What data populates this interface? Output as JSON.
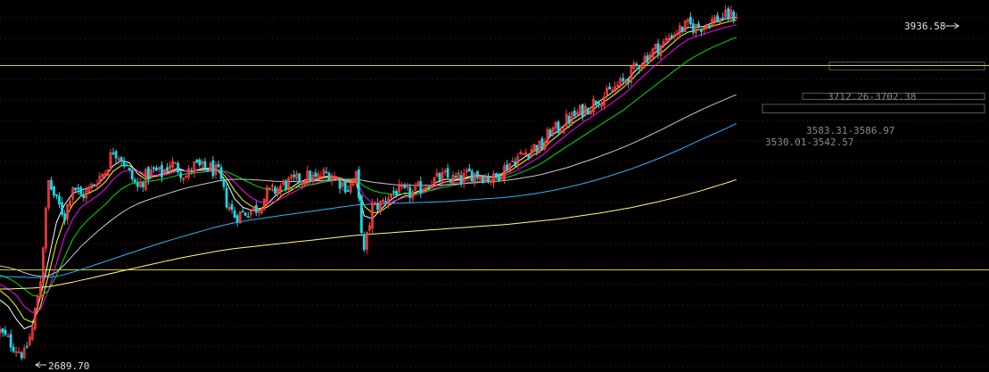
{
  "chart_data": {
    "type": "candlestick",
    "y_scale": "log",
    "ylim": [
      2650,
      4000
    ],
    "grid": true,
    "colors": {
      "background": "#000000",
      "grid": "#8b0000",
      "up": "#ff3c3c",
      "down": "#18d8e8",
      "level_line": "#d4d400",
      "zone_border": "#5a5a5a"
    },
    "annotations": {
      "high_label": "3936.58",
      "low_label": "2689.70",
      "zones": [
        {
          "label": "3712.26-3702.38",
          "low": 3702.38,
          "high": 3712.26
        },
        {
          "label": "3583.31-3586.97",
          "low": 3583.31,
          "high": 3586.97
        },
        {
          "label": "3530.01-3542.57",
          "low": 3530.01,
          "high": 3542.57
        }
      ],
      "horizontal_levels": [
        3720,
        2970
      ]
    },
    "indices": [
      0,
      3,
      6,
      9,
      12,
      15,
      18,
      21,
      24,
      27,
      30,
      33,
      36,
      39,
      42,
      45,
      48,
      51,
      54,
      57,
      60,
      63,
      66,
      69,
      72,
      75,
      78,
      81,
      84,
      87,
      90,
      93,
      96,
      99,
      102,
      105,
      108,
      111,
      114,
      117,
      120,
      123,
      126,
      129,
      132,
      135,
      138,
      141,
      144,
      147,
      150,
      153,
      156,
      159,
      162,
      165,
      168,
      171,
      174,
      177,
      180,
      183,
      186,
      189,
      192,
      195,
      198,
      201,
      204,
      207,
      210,
      213,
      216,
      219,
      222,
      225,
      228,
      231,
      234,
      237,
      240,
      243,
      246,
      249,
      252,
      255,
      258,
      261,
      264,
      267,
      270,
      273,
      276,
      279,
      282,
      285,
      288,
      291,
      294,
      297,
      300,
      303,
      306,
      309,
      312,
      315,
      318,
      321,
      324,
      327,
      330,
      333,
      336,
      339,
      342,
      345,
      348,
      351,
      354,
      357,
      360
    ],
    "closes": [
      2770,
      2745,
      2720,
      2700,
      2780,
      2940,
      3270,
      3200,
      3150,
      3260,
      3220,
      3240,
      3280,
      3310,
      3390,
      3360,
      3300,
      3250,
      3290,
      3310,
      3300,
      3340,
      3320,
      3290,
      3330,
      3320,
      3320,
      3300,
      3200,
      3150,
      3160,
      3170,
      3180,
      3230,
      3240,
      3260,
      3270,
      3280,
      3290,
      3280,
      3300,
      3300,
      3270,
      3250,
      3290,
      3020,
      3180,
      3190,
      3220,
      3240,
      3230,
      3230,
      3250,
      3270,
      3280,
      3290,
      3280,
      3280,
      3300,
      3300,
      3290,
      3280,
      3310,
      3340,
      3360,
      3380,
      3400,
      3400,
      3460,
      3470,
      3500,
      3520,
      3540,
      3560,
      3590,
      3600,
      3630,
      3650,
      3690,
      3730,
      3760,
      3790,
      3810,
      3850,
      3870,
      3890,
      3880,
      3890,
      3910,
      3920,
      3930,
      3936.58
    ],
    "ma_series": [
      {
        "values": [
          2870,
          2850,
          2810,
          2780,
          2790,
          2880,
          3000,
          3130,
          3190,
          3230,
          3240,
          3250,
          3260,
          3290,
          3330,
          3350,
          3340,
          3300,
          3280,
          3290,
          3300,
          3310,
          3320,
          3310,
          3310,
          3320,
          3320,
          3310,
          3270,
          3210,
          3180,
          3170,
          3170,
          3190,
          3220,
          3240,
          3250,
          3270,
          3280,
          3280,
          3290,
          3290,
          3280,
          3270,
          3270,
          3150,
          3140,
          3170,
          3200,
          3220,
          3230,
          3230,
          3240,
          3250,
          3270,
          3280,
          3280,
          3280,
          3290,
          3295,
          3292,
          3288,
          3300,
          3320,
          3345,
          3365,
          3385,
          3400,
          3440,
          3460,
          3490,
          3510,
          3530,
          3550,
          3575,
          3595,
          3620,
          3645,
          3680,
          3715,
          3745,
          3775,
          3800,
          3835,
          3860,
          3880,
          3880,
          3885,
          3900,
          3910,
          3920,
          3925
        ]
      },
      {
        "values": [
          2900,
          2880,
          2850,
          2810,
          2800,
          2850,
          2950,
          3060,
          3140,
          3190,
          3220,
          3230,
          3245,
          3270,
          3310,
          3330,
          3330,
          3310,
          3290,
          3290,
          3295,
          3305,
          3315,
          3310,
          3310,
          3315,
          3320,
          3315,
          3285,
          3240,
          3205,
          3185,
          3175,
          3180,
          3200,
          3225,
          3240,
          3260,
          3270,
          3275,
          3285,
          3290,
          3285,
          3275,
          3270,
          3185,
          3160,
          3165,
          3185,
          3205,
          3220,
          3225,
          3235,
          3245,
          3260,
          3270,
          3275,
          3278,
          3285,
          3290,
          3290,
          3288,
          3295,
          3310,
          3330,
          3350,
          3370,
          3388,
          3420,
          3445,
          3470,
          3495,
          3515,
          3535,
          3560,
          3580,
          3605,
          3630,
          3660,
          3695,
          3725,
          3755,
          3780,
          3810,
          3840,
          3860,
          3868,
          3875,
          3885,
          3895,
          3905,
          3912
        ]
      },
      {
        "values": [
          2920,
          2905,
          2885,
          2850,
          2830,
          2840,
          2900,
          2990,
          3080,
          3140,
          3180,
          3200,
          3220,
          3245,
          3280,
          3305,
          3315,
          3310,
          3300,
          3295,
          3295,
          3300,
          3310,
          3310,
          3310,
          3312,
          3315,
          3315,
          3300,
          3270,
          3240,
          3215,
          3200,
          3195,
          3200,
          3215,
          3230,
          3245,
          3258,
          3265,
          3275,
          3282,
          3282,
          3278,
          3275,
          3220,
          3195,
          3190,
          3195,
          3205,
          3215,
          3220,
          3228,
          3238,
          3250,
          3260,
          3266,
          3270,
          3277,
          3283,
          3285,
          3285,
          3290,
          3300,
          3315,
          3332,
          3350,
          3368,
          3395,
          3420,
          3445,
          3470,
          3492,
          3512,
          3535,
          3555,
          3578,
          3602,
          3630,
          3662,
          3692,
          3722,
          3750,
          3778,
          3805,
          3828,
          3842,
          3852,
          3864,
          3874,
          3884,
          3892
        ]
      },
      {
        "values": [
          2950,
          2940,
          2925,
          2905,
          2885,
          2880,
          2900,
          2950,
          3010,
          3070,
          3110,
          3140,
          3165,
          3190,
          3220,
          3245,
          3262,
          3270,
          3272,
          3275,
          3280,
          3287,
          3295,
          3300,
          3303,
          3306,
          3310,
          3312,
          3308,
          3295,
          3280,
          3265,
          3252,
          3244,
          3240,
          3240,
          3245,
          3252,
          3258,
          3263,
          3270,
          3275,
          3278,
          3278,
          3278,
          3255,
          3240,
          3232,
          3228,
          3227,
          3228,
          3230,
          3233,
          3238,
          3245,
          3252,
          3258,
          3263,
          3268,
          3273,
          3276,
          3278,
          3282,
          3290,
          3300,
          3312,
          3325,
          3340,
          3360,
          3380,
          3400,
          3420,
          3440,
          3460,
          3480,
          3500,
          3520,
          3540,
          3565,
          3590,
          3615,
          3640,
          3665,
          3690,
          3715,
          3740,
          3760,
          3778,
          3795,
          3810,
          3825,
          3838
        ]
      },
      {
        "values": [
          2980,
          2975,
          2968,
          2958,
          2950,
          2946,
          2948,
          2960,
          2985,
          3015,
          3045,
          3070,
          3095,
          3118,
          3140,
          3160,
          3178,
          3192,
          3203,
          3213,
          3222,
          3231,
          3240,
          3248,
          3255,
          3262,
          3268,
          3274,
          3278,
          3280,
          3280,
          3279,
          3277,
          3275,
          3273,
          3272,
          3272,
          3272,
          3273,
          3274,
          3276,
          3278,
          3279,
          3280,
          3281,
          3275,
          3270,
          3266,
          3263,
          3260,
          3259,
          3258,
          3258,
          3258,
          3259,
          3260,
          3262,
          3264,
          3266,
          3268,
          3270,
          3272,
          3274,
          3278,
          3282,
          3287,
          3292,
          3298,
          3306,
          3314,
          3322,
          3332,
          3342,
          3352,
          3363,
          3374,
          3386,
          3398,
          3411,
          3425,
          3439,
          3454,
          3469,
          3485,
          3501,
          3517,
          3532,
          3547,
          3561,
          3575,
          3589,
          3602
        ]
      },
      {
        "values": [
          2945,
          2945,
          2944,
          2943,
          2942,
          2942,
          2943,
          2946,
          2952,
          2960,
          2968,
          2977,
          2986,
          2995,
          3004,
          3013,
          3022,
          3031,
          3040,
          3049,
          3058,
          3066,
          3074,
          3082,
          3090,
          3098,
          3106,
          3113,
          3120,
          3126,
          3131,
          3136,
          3140,
          3144,
          3148,
          3152,
          3156,
          3160,
          3164,
          3168,
          3172,
          3176,
          3180,
          3184,
          3188,
          3190,
          3191,
          3192,
          3193,
          3194,
          3195,
          3196,
          3197,
          3198,
          3199,
          3200,
          3202,
          3204,
          3206,
          3208,
          3210,
          3212,
          3214,
          3217,
          3220,
          3224,
          3228,
          3233,
          3238,
          3244,
          3250,
          3257,
          3264,
          3272,
          3280,
          3289,
          3298,
          3308,
          3318,
          3329,
          3340,
          3352,
          3364,
          3377,
          3390,
          3404,
          3418,
          3432,
          3446,
          3460,
          3474,
          3489
        ]
      },
      {
        "values": [
          2905,
          2905,
          2906,
          2907,
          2908,
          2910,
          2913,
          2917,
          2922,
          2927,
          2933,
          2939,
          2945,
          2951,
          2957,
          2963,
          2969,
          2975,
          2981,
          2987,
          2993,
          2999,
          3005,
          3010,
          3015,
          3020,
          3025,
          3030,
          3034,
          3038,
          3041,
          3044,
          3047,
          3050,
          3053,
          3056,
          3059,
          3062,
          3065,
          3068,
          3071,
          3074,
          3077,
          3080,
          3083,
          3085,
          3087,
          3089,
          3091,
          3093,
          3095,
          3097,
          3099,
          3101,
          3103,
          3105,
          3107,
          3109,
          3111,
          3113,
          3115,
          3117,
          3119,
          3121,
          3124,
          3127,
          3130,
          3133,
          3136,
          3139,
          3143,
          3147,
          3151,
          3155,
          3159,
          3164,
          3169,
          3174,
          3179,
          3185,
          3191,
          3197,
          3204,
          3211,
          3218,
          3226,
          3234,
          3242,
          3251,
          3260,
          3269,
          3279
        ]
      }
    ],
    "ma_colors": [
      "#ffffff",
      "#ffff00",
      "#ff00ff",
      "#00e000",
      "#c8c8c8",
      "#2ab4ff",
      "#ffff80"
    ]
  }
}
